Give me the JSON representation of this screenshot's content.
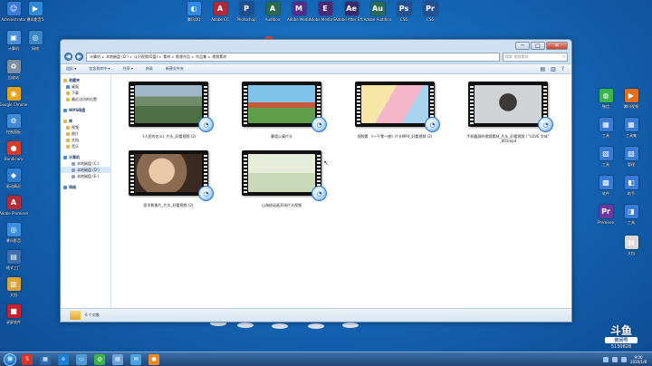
{
  "desktop": {
    "left_icons": [
      {
        "label": "Administrator",
        "color": "#3a7bd5",
        "glyph": "☺"
      },
      {
        "label": "暴风影音5",
        "color": "#2f8ad8",
        "glyph": "▶"
      },
      {
        "label": "计算机",
        "color": "#4a90d9",
        "glyph": "▣"
      },
      {
        "label": "网络",
        "color": "#3a86c8",
        "glyph": "◎"
      },
      {
        "label": "回收站",
        "color": "#7d8fa3",
        "glyph": "♻"
      },
      {
        "label": "Google Chrome",
        "color": "#e6a31f",
        "glyph": "◉"
      },
      {
        "label": "控制面板",
        "color": "#3e8bd6",
        "glyph": "⚙"
      },
      {
        "label": "Bandicam",
        "color": "#d83b2b",
        "glyph": "●"
      },
      {
        "label": "驱动精灵",
        "color": "#2e7fd0",
        "glyph": "◆"
      },
      {
        "label": "Adobe Premiere",
        "color": "#b42c3a",
        "glyph": "A"
      },
      {
        "label": "暴风影音",
        "color": "#3a8fe0",
        "glyph": "◎"
      },
      {
        "label": "格式工厂",
        "color": "#3d6fae",
        "glyph": "▤"
      },
      {
        "label": "文档",
        "color": "#d9a23a",
        "glyph": "▥"
      },
      {
        "label": "录屏软件",
        "color": "#c8202d",
        "glyph": "■"
      }
    ],
    "top_icons": [
      {
        "label": "腾讯QQ",
        "color": "#2e8ae6",
        "glyph": "◐"
      },
      {
        "label": "Adobe CC",
        "color": "#b0283a",
        "glyph": "A"
      },
      {
        "label": "Photoshop",
        "color": "#1f4f8f",
        "glyph": "P"
      },
      {
        "label": "Audition",
        "color": "#2a6a50",
        "glyph": "A"
      },
      {
        "label": "Adobe Media",
        "color": "#5a2a8a",
        "glyph": "M"
      },
      {
        "label": "Adobe Media Encoder",
        "color": "#4a2a7a",
        "glyph": "E"
      },
      {
        "label": "Adobe After Effects",
        "color": "#3a2a6a",
        "glyph": "Ae"
      },
      {
        "label": "Adobe Audition",
        "color": "#2a6a55",
        "glyph": "Au"
      },
      {
        "label": "CS6",
        "color": "#2a4f8f",
        "glyph": "Ps"
      },
      {
        "label": "CS6",
        "color": "#2a4f8f",
        "glyph": "Pr"
      }
    ],
    "right_icons": [
      {
        "label": "微信",
        "color": "#3bb54a",
        "glyph": "◍"
      },
      {
        "label": "腾讯视频",
        "color": "#e07020",
        "glyph": "▶"
      },
      {
        "label": "工具",
        "color": "#3a7bd5",
        "glyph": "▦"
      },
      {
        "label": "工具集",
        "color": "#3a7bd5",
        "glyph": "▦"
      },
      {
        "label": "工具",
        "color": "#3a7bd5",
        "glyph": "▧"
      },
      {
        "label": "管理",
        "color": "#3a7bd5",
        "glyph": "▨"
      },
      {
        "label": "软件",
        "color": "#3a7bd5",
        "glyph": "▩"
      },
      {
        "label": "助手",
        "color": "#3a7bd5",
        "glyph": "◧"
      },
      {
        "label": "Premiere",
        "color": "#6a3a9a",
        "glyph": "Pr"
      },
      {
        "label": "工具",
        "color": "#3a7bd5",
        "glyph": "◨"
      },
      {
        "label": "文档",
        "color": "#d9d9d9",
        "glyph": "▤"
      }
    ]
  },
  "window": {
    "controls": {
      "minimize": "─",
      "maximize": "□",
      "close": "✕"
    },
    "back": "◀",
    "forward": "▶",
    "address": [
      "计算机",
      "本地磁盘 (D:)",
      "认识视频(D盘)",
      "素材",
      "影视作品",
      "作品集",
      "视频素材"
    ],
    "search_placeholder": "搜索 视频素材",
    "search_icon": "⚲",
    "toolbar": [
      "组织 ▾",
      "包含到库中 ▾",
      "共享 ▾",
      "刻录",
      "新建文件夹"
    ],
    "toolbar_right": [
      "▤",
      "▥",
      "?"
    ],
    "nav": [
      {
        "kind": "head",
        "label": "收藏夹",
        "icon": ""
      },
      {
        "kind": "item",
        "label": "桌面",
        "icon": "blue"
      },
      {
        "kind": "item",
        "label": "下载",
        "icon": ""
      },
      {
        "kind": "item",
        "label": "最近访问的位置",
        "icon": ""
      },
      {
        "kind": "gap"
      },
      {
        "kind": "head",
        "label": "WPS网盘",
        "icon": "blue"
      },
      {
        "kind": "gap"
      },
      {
        "kind": "head",
        "label": "库",
        "icon": ""
      },
      {
        "kind": "item",
        "label": "视频",
        "icon": ""
      },
      {
        "kind": "item",
        "label": "图片",
        "icon": ""
      },
      {
        "kind": "item",
        "label": "文档",
        "icon": ""
      },
      {
        "kind": "item",
        "label": "音乐",
        "icon": ""
      },
      {
        "kind": "gap"
      },
      {
        "kind": "head",
        "label": "计算机",
        "icon": "blue"
      },
      {
        "kind": "sub",
        "label": "本地磁盘 (C:)",
        "icon": "gray"
      },
      {
        "kind": "sub",
        "label": "本地磁盘 (D:)",
        "icon": "gray",
        "selected": true
      },
      {
        "kind": "sub",
        "label": "本地磁盘 (E:)",
        "icon": "gray"
      },
      {
        "kind": "gap"
      },
      {
        "kind": "head",
        "label": "网络",
        "icon": "blue"
      }
    ],
    "files": [
      {
        "name": "《人民的名义》片头_好看视频 (2)",
        "scene": "city"
      },
      {
        "name": "幕墙公寓片头",
        "scene": "buildings"
      },
      {
        "name": "视频素 《一千零一夜》片头MP4_好看视频 (2)",
        "scene": "cartoon"
      },
      {
        "name": "手机截屏的视频素材_片头_好看视频 / \"LOVE 字体\" _001mp4",
        "scene": "silhouette"
      },
      {
        "name": "医学影像片_片头_好看视频 (2)",
        "scene": "face"
      },
      {
        "name": "山海经动画开场片头视频",
        "scene": "sketch"
      }
    ],
    "badge_glyph": "◔",
    "status": "6 个对象"
  },
  "taskbar": {
    "start": "⊞",
    "apps": [
      {
        "label": "搜狗",
        "color": "#d8342a",
        "glyph": "S"
      },
      {
        "label": "资源管理器",
        "color": "#2b6cb0",
        "glyph": "▦"
      },
      {
        "label": "浏览器",
        "color": "#1b7fd8",
        "glyph": "e"
      },
      {
        "label": "窗口",
        "color": "#4f9ad6",
        "glyph": "▭"
      },
      {
        "label": "微信",
        "color": "#3bb54a",
        "glyph": "◍"
      },
      {
        "label": "工具",
        "color": "#6fa0d6",
        "glyph": "▤"
      },
      {
        "label": "邮件",
        "color": "#4aa0e0",
        "glyph": "✉"
      },
      {
        "label": "录屏",
        "color": "#f08a24",
        "glyph": "●"
      }
    ],
    "clock_time": "9:00",
    "clock_date": "2020/1/8"
  },
  "watermark": {
    "brand": "斗鱼",
    "sub": "房间号",
    "room": "5130828"
  }
}
